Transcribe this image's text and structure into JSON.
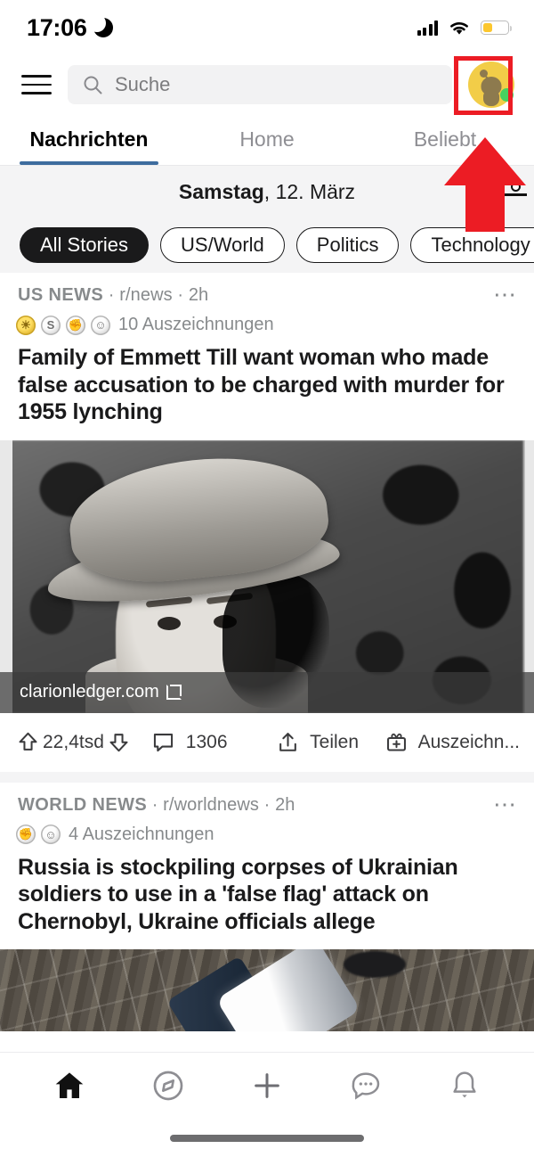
{
  "status_bar": {
    "time": "17:06",
    "dnd_icon": "moon-icon",
    "signal_icon": "cellular-signal-icon",
    "wifi_icon": "wifi-icon",
    "battery_icon": "battery-low-power-icon",
    "battery_color": "#fcc72e"
  },
  "top_bar": {
    "menu_icon": "hamburger-menu-icon",
    "search": {
      "placeholder": "Suche",
      "value": "",
      "icon": "search-icon"
    },
    "avatar": {
      "icon": "reddit-snoo-avatar",
      "online": true,
      "online_color": "#46d160",
      "bg_color": "#f2cd48"
    }
  },
  "annotation": {
    "highlight_box_color": "#ec1c24",
    "arrow_color": "#ec1c24",
    "arrow_icon": "up-arrow-annotation",
    "target": "avatar"
  },
  "tabs": [
    {
      "label": "Nachrichten",
      "active": true
    },
    {
      "label": "Home",
      "active": false
    },
    {
      "label": "Beliebt",
      "active": false
    }
  ],
  "tab_accent_color": "#3d6c9e",
  "date_row": {
    "weekday": "Samstag",
    "rest": ", 12. März",
    "settings_icon": "slider-settings-icon"
  },
  "chips": [
    {
      "label": "All Stories",
      "active": true
    },
    {
      "label": "US/World",
      "active": false
    },
    {
      "label": "Politics",
      "active": false
    },
    {
      "label": "Technology",
      "active": false
    }
  ],
  "posts": [
    {
      "category": "US NEWS",
      "subreddit": "r/news",
      "age": "2h",
      "separator": " · ",
      "overflow_icon": "more-options-icon",
      "awards": [
        {
          "name": "gold-award-icon",
          "tier": "gold",
          "glyph": "☀"
        },
        {
          "name": "silver-s-award-icon",
          "tier": "silver",
          "glyph": "S"
        },
        {
          "name": "helpful-award-icon",
          "tier": "silver",
          "glyph": "✊"
        },
        {
          "name": "wholesome-award-icon",
          "tier": "silver",
          "glyph": "☺"
        }
      ],
      "awards_label": "10 Auszeichnungen",
      "title": "Family of Emmett Till want woman who made false accusation to be charged with murder for 1955 lynching",
      "media_type": "photo",
      "media_alt": "black-and-white portrait of a boy wearing a hat",
      "domain": "clarionledger.com",
      "domain_icon": "external-link-icon",
      "actions": {
        "upvote_icon": "upvote-arrow-icon",
        "score": "22,4tsd",
        "downvote_icon": "downvote-arrow-icon",
        "comment_icon": "comment-bubble-icon",
        "comments": "1306",
        "share_icon": "share-icon",
        "share_label": "Teilen",
        "award_icon": "give-award-icon",
        "award_label": "Auszeichn..."
      }
    },
    {
      "category": "WORLD NEWS",
      "subreddit": "r/worldnews",
      "age": "2h",
      "separator": " · ",
      "overflow_icon": "more-options-icon",
      "awards": [
        {
          "name": "helpful-award-icon",
          "tier": "silver",
          "glyph": "✊"
        },
        {
          "name": "wholesome-award-icon",
          "tier": "silver",
          "glyph": "☺"
        }
      ],
      "awards_label": "4 Auszeichnungen",
      "title": "Russia is stockpiling corpses of Ukrainian soldiers to use in a 'false flag' attack on Chernobyl, Ukraine officials allege",
      "media_type": "photo",
      "media_alt": "satellite image of the Chernobyl nuclear plant"
    }
  ],
  "bottom_nav": [
    {
      "name": "nav-home",
      "icon": "home-icon",
      "active": true
    },
    {
      "name": "nav-discover",
      "icon": "compass-icon",
      "active": false
    },
    {
      "name": "nav-create",
      "icon": "plus-icon",
      "active": false
    },
    {
      "name": "nav-chat",
      "icon": "chat-bubble-icon",
      "active": false
    },
    {
      "name": "nav-notifications",
      "icon": "bell-icon",
      "active": false
    }
  ]
}
